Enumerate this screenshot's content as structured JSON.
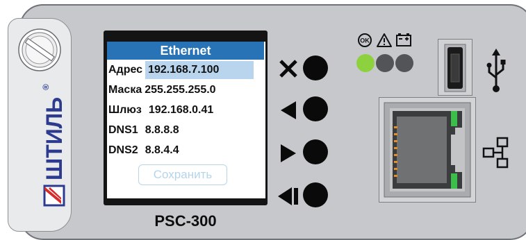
{
  "brand": {
    "name": "ШТИЛЬ",
    "registered_mark": "®"
  },
  "screen": {
    "title": "Ethernet",
    "fields": [
      {
        "label": "Адрес",
        "value": "192.168.7.100",
        "selected": true
      },
      {
        "label": "Маска",
        "value": "255.255.255.0",
        "selected": false
      },
      {
        "label": "Шлюз",
        "value": "192.168.0.41",
        "selected": false
      },
      {
        "label": "DNS1",
        "value": "8.8.8.8",
        "selected": false
      },
      {
        "label": "DNS2",
        "value": "8.8.4.4",
        "selected": false
      }
    ],
    "save_label": "Сохранить"
  },
  "model": "PSC-300",
  "buttons": [
    {
      "name": "cancel",
      "icon": "close-icon"
    },
    {
      "name": "left",
      "icon": "arrow-left-icon"
    },
    {
      "name": "right",
      "icon": "arrow-right-icon"
    },
    {
      "name": "back",
      "icon": "step-back-icon"
    }
  ],
  "status": {
    "ok_label": "OK",
    "indicators": [
      {
        "icon": "ok-icon",
        "led": "on",
        "color": "#8dd13f"
      },
      {
        "icon": "warning-icon",
        "led": "off",
        "color": "#525457"
      },
      {
        "icon": "battery-icon",
        "led": "off",
        "color": "#525457"
      }
    ]
  },
  "ports": {
    "usb_icon": "usb-icon",
    "ethernet_icon": "network-icon"
  }
}
